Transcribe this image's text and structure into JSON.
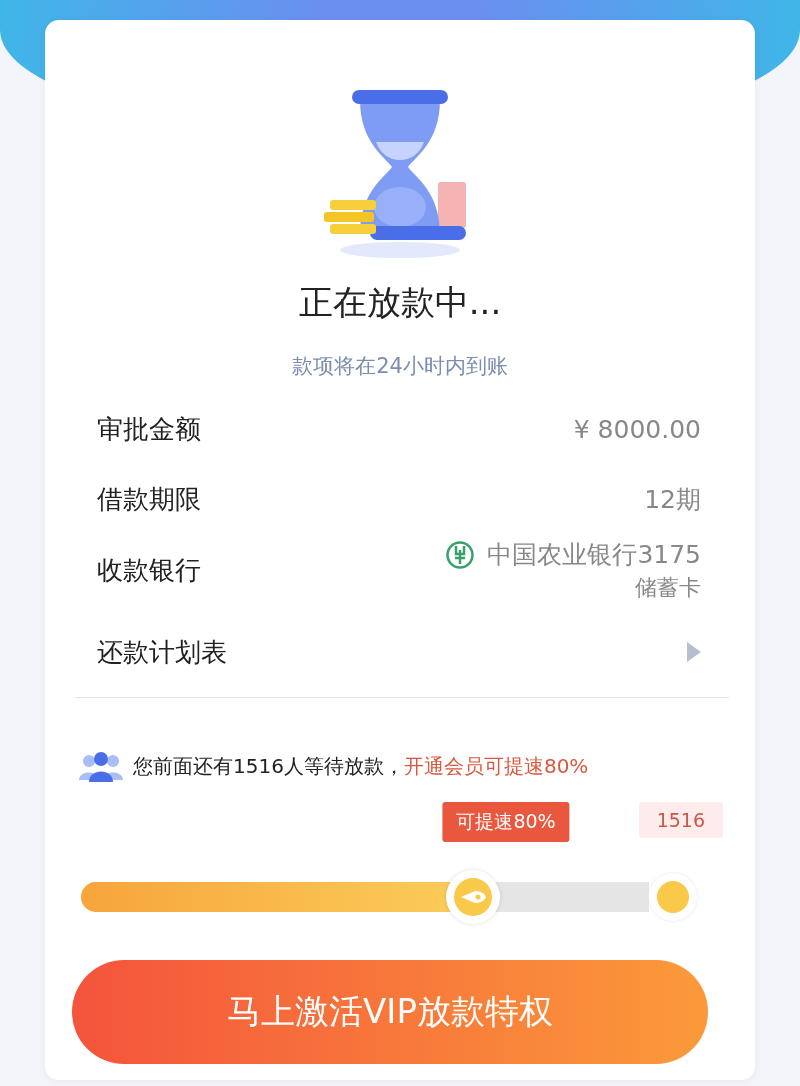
{
  "status": {
    "title": "正在放款中...",
    "subtitle": "款项将在24小时内到账"
  },
  "details": [
    {
      "kind": "text",
      "label": "审批金额",
      "value": "¥ 8000.00"
    },
    {
      "kind": "text",
      "label": "借款期限",
      "value": "12期"
    },
    {
      "kind": "bank",
      "label": "收款银行",
      "value": "中国农业银行3175",
      "note": "储蓄卡"
    },
    {
      "kind": "link",
      "label": "还款计划表"
    }
  ],
  "queue": {
    "text": "您前面还有1516人等待放款，",
    "highlight": "开通会员可提速80%"
  },
  "progress": {
    "level": 0.69,
    "tooltip": "可提速80%",
    "end_label": "1516"
  },
  "button": {
    "label": "马上激活VIP放款特权"
  }
}
